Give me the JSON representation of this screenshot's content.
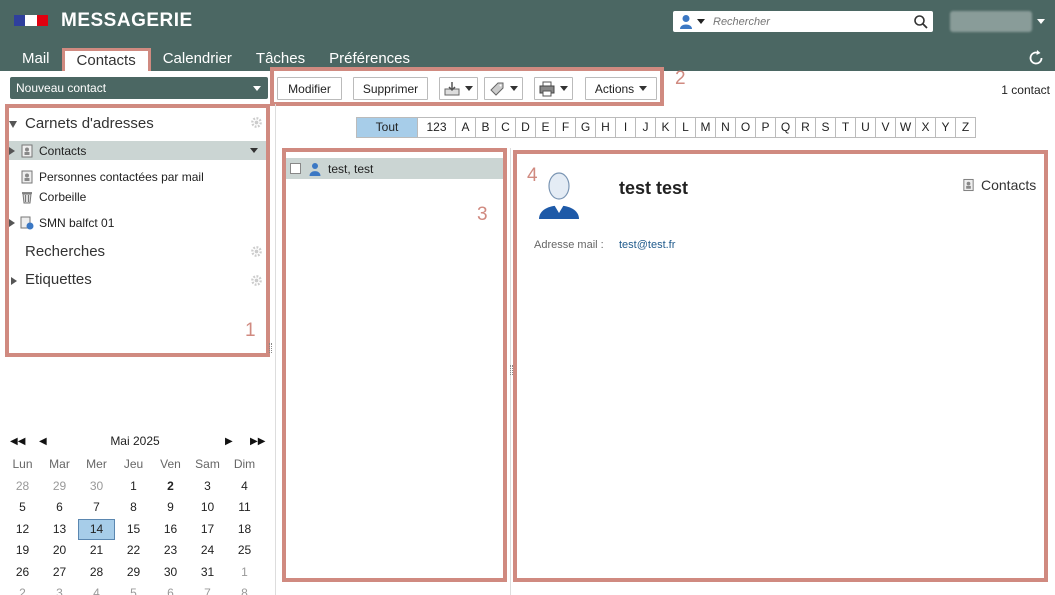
{
  "header": {
    "brand": "MESSAGERIE",
    "search_placeholder": "Rechercher",
    "flag_colors": [
      "#2f3f9d",
      "#ffffff",
      "#e1000f"
    ]
  },
  "nav": {
    "tabs": [
      {
        "label": "Mail",
        "active": false
      },
      {
        "label": "Contacts",
        "active": true
      },
      {
        "label": "Calendrier",
        "active": false
      },
      {
        "label": "Tâches",
        "active": false
      },
      {
        "label": "Préférences",
        "active": false
      }
    ],
    "refresh_icon": "refresh-icon"
  },
  "sidebar": {
    "new_contact_label": "Nouveau contact",
    "address_books_title": "Carnets d'adresses",
    "books": [
      {
        "label": "Contacts",
        "selected": true,
        "icon": "address-book-icon"
      },
      {
        "label": "Personnes contactées par mail",
        "selected": false,
        "icon": "address-book-icon"
      },
      {
        "label": "Corbeille",
        "selected": false,
        "icon": "trash-icon"
      },
      {
        "label": "SMN balfct 01",
        "selected": false,
        "icon": "shared-book-icon"
      }
    ],
    "searches_title": "Recherches",
    "labels_title": "Etiquettes",
    "box_number": "1"
  },
  "toolbar": {
    "modify_label": "Modifier",
    "delete_label": "Supprimer",
    "actions_label": "Actions",
    "box_number": "2",
    "contact_count": "1 contact"
  },
  "alphabet": {
    "all": "Tout",
    "numbers": "123",
    "letters": [
      "A",
      "B",
      "C",
      "D",
      "E",
      "F",
      "G",
      "H",
      "I",
      "J",
      "K",
      "L",
      "M",
      "N",
      "O",
      "P",
      "Q",
      "R",
      "S",
      "T",
      "U",
      "V",
      "W",
      "X",
      "Y",
      "Z"
    ]
  },
  "list": {
    "box_number": "3",
    "contacts": [
      {
        "name": "test, test"
      }
    ]
  },
  "detail": {
    "box_number": "4",
    "full_name": "test test",
    "address_book": "Contacts",
    "email_label": "Adresse mail :",
    "email": "test@test.fr"
  },
  "calendar": {
    "month_title": "Mai 2025",
    "weekdays": [
      "Lun",
      "Mar",
      "Mer",
      "Jeu",
      "Ven",
      "Sam",
      "Dim"
    ],
    "weeks": [
      [
        "28",
        "29",
        "30",
        "1",
        "2",
        "3",
        "4"
      ],
      [
        "5",
        "6",
        "7",
        "8",
        "9",
        "10",
        "11"
      ],
      [
        "12",
        "13",
        "14",
        "15",
        "16",
        "17",
        "18"
      ],
      [
        "19",
        "20",
        "21",
        "22",
        "23",
        "24",
        "25"
      ],
      [
        "26",
        "27",
        "28",
        "29",
        "30",
        "31",
        "1"
      ],
      [
        "2",
        "3",
        "4",
        "5",
        "6",
        "7",
        "8"
      ]
    ],
    "today": "14"
  },
  "colors": {
    "header_bg": "#4b6763",
    "highlight_border": "#d08a80",
    "selected_row": "#cbd5d3",
    "today_bg": "#a7cde9",
    "link": "#1f5a8c"
  }
}
